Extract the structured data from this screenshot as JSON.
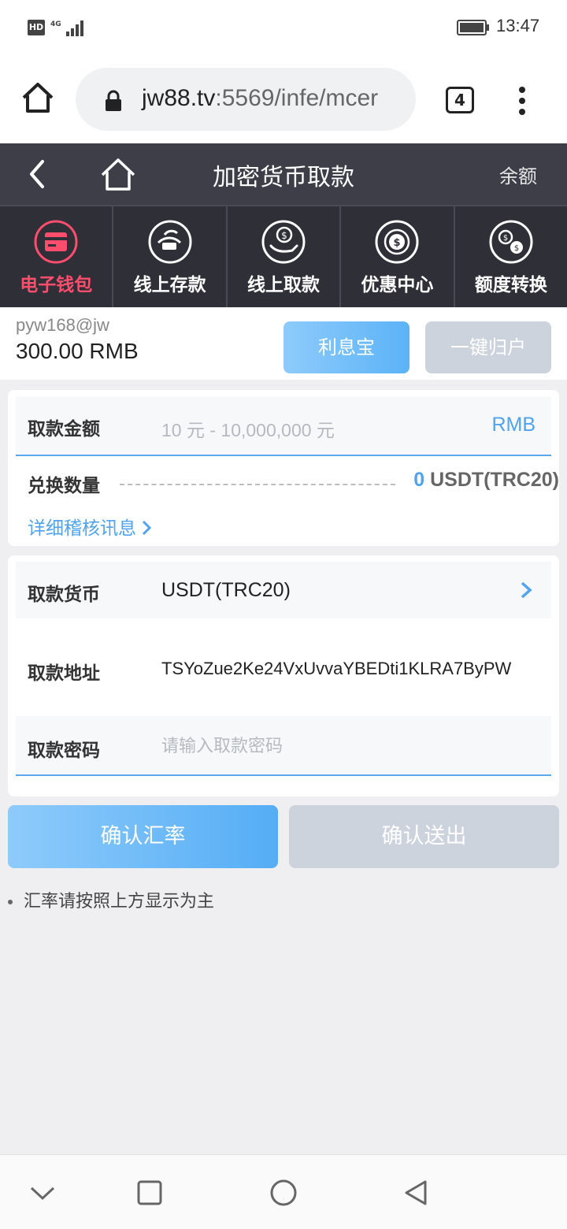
{
  "status_bar": {
    "network_badge": "HD",
    "network_type": "4G",
    "time": "13:47"
  },
  "browser": {
    "url_host": "jw88.tv",
    "url_path": ":5569/infe/mcer",
    "tab_count": "4"
  },
  "header": {
    "title": "加密货币取款",
    "balance_link": "余额"
  },
  "nav_tabs": [
    {
      "label": "电子钱包",
      "icon": "wallet-icon",
      "active": true
    },
    {
      "label": "线上存款",
      "icon": "deposit-icon",
      "active": false
    },
    {
      "label": "线上取款",
      "icon": "withdraw-icon",
      "active": false
    },
    {
      "label": "优惠中心",
      "icon": "promo-icon",
      "active": false
    },
    {
      "label": "额度转换",
      "icon": "transfer-icon",
      "active": false
    }
  ],
  "account": {
    "username": "pyw168@jw",
    "balance": "300.00 RMB",
    "interest_button": "利息宝",
    "collect_button": "一键归户"
  },
  "withdraw_form": {
    "amount_label": "取款金额",
    "amount_placeholder": "10 元 - 10,000,000 元",
    "amount_unit": "RMB",
    "exchange_label": "兑换数量",
    "exchange_value": "0",
    "exchange_unit": "USDT(TRC20)",
    "detail_link": "详细稽核讯息",
    "currency_label": "取款货币",
    "currency_value": "USDT(TRC20)",
    "address_label": "取款地址",
    "address_value": "TSYoZue2Ke24VxUvvaYBEDti1KLRA7ByPW",
    "password_label": "取款密码",
    "password_placeholder": "请输入取款密码"
  },
  "actions": {
    "confirm_rate": "确认汇率",
    "confirm_send": "确认送出"
  },
  "note": "汇率请按照上方显示为主",
  "colors": {
    "accent_blue": "#4fa3ef",
    "active_pink": "#ff4d6d",
    "header_bg": "#3d3e48",
    "nav_bg": "#2f2f38"
  }
}
